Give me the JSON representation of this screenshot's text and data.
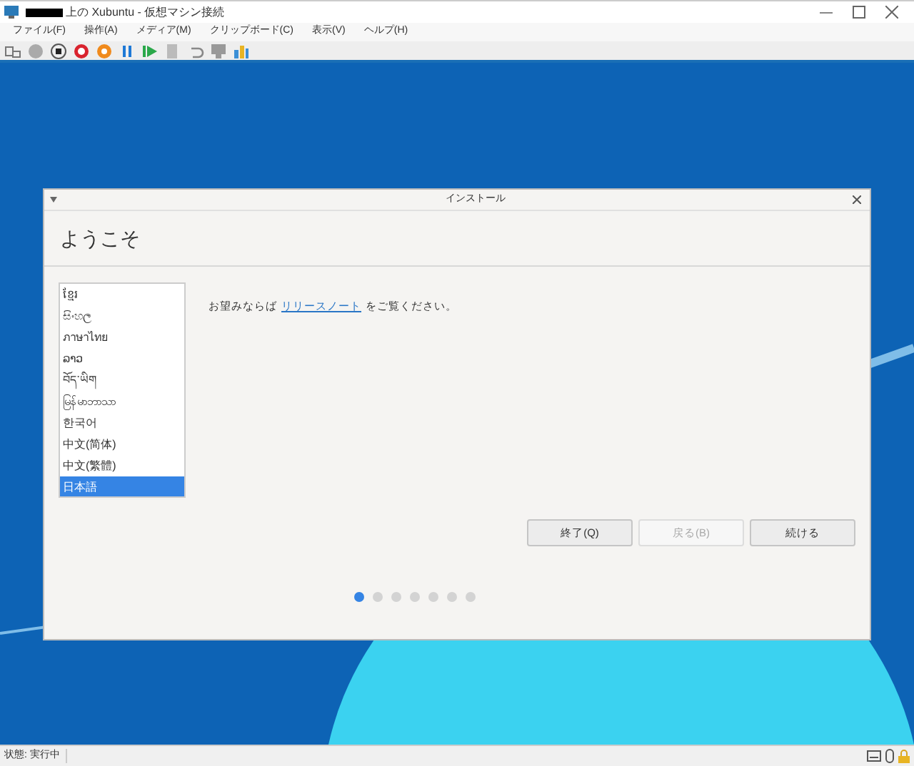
{
  "window": {
    "title": "上の Xubuntu - 仮想マシン接続"
  },
  "menu": [
    "ファイル(F)",
    "操作(A)",
    "メディア(M)",
    "クリップボード(C)",
    "表示(V)",
    "ヘルプ(H)"
  ],
  "dialog": {
    "title": "インストール",
    "heading": "ようこそ",
    "languages": [
      {
        "label": "ខ្មែរ",
        "selected": false
      },
      {
        "label": "සිංහල",
        "selected": false
      },
      {
        "label": "ภาษาไทย",
        "selected": false
      },
      {
        "label": "ລາວ",
        "selected": false
      },
      {
        "label": "བོད་ཡིག",
        "selected": false
      },
      {
        "label": "မြန်မာဘာသာ",
        "selected": false
      },
      {
        "label": "한국어",
        "selected": false
      },
      {
        "label": "中文(简体)",
        "selected": false
      },
      {
        "label": "中文(繁體)",
        "selected": false
      },
      {
        "label": "日本語",
        "selected": true
      }
    ],
    "message_before": "お望みならば",
    "link": "リリースノート",
    "message_after": "をご覧ください。",
    "buttons": [
      {
        "label": "終了(Q)",
        "disabled": false
      },
      {
        "label": "戻る(B)",
        "disabled": true
      },
      {
        "label": "続ける",
        "disabled": false
      }
    ],
    "steps": [
      {
        "selected": true
      },
      {
        "selected": false
      },
      {
        "selected": false
      },
      {
        "selected": false
      },
      {
        "selected": false
      },
      {
        "selected": false
      },
      {
        "selected": false
      }
    ]
  },
  "status_bar": {
    "text": "状態: 実行中"
  }
}
